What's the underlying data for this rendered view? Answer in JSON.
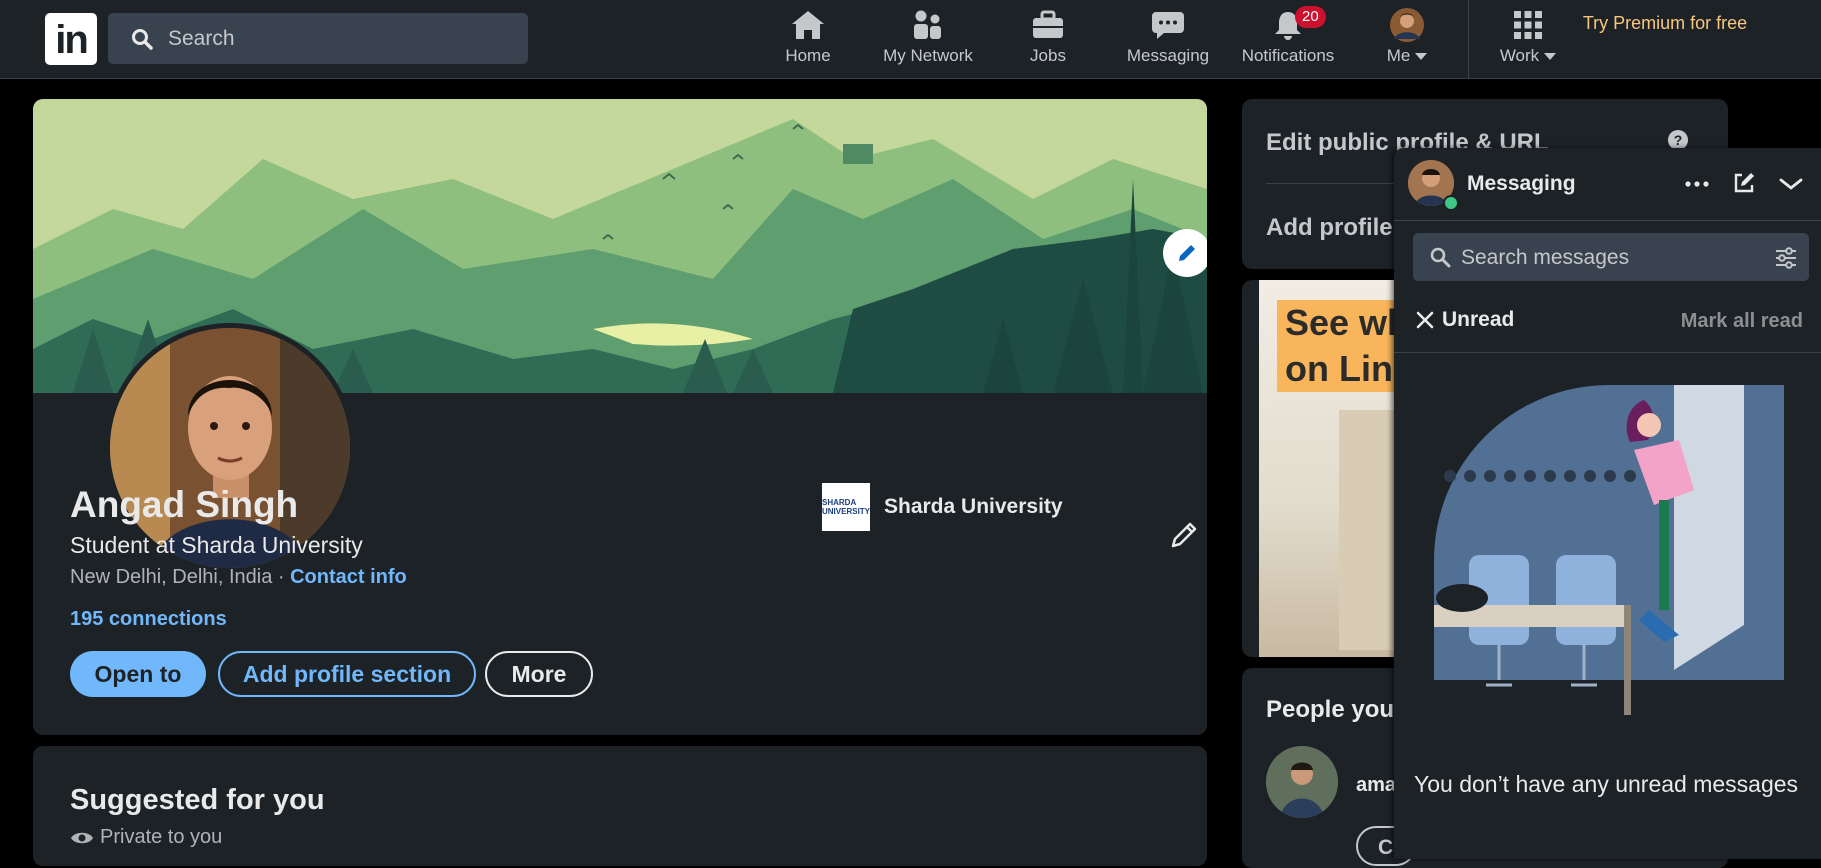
{
  "nav": {
    "search_placeholder": "Search",
    "items": [
      {
        "label": "Home",
        "icon": "home-icon"
      },
      {
        "label": "My Network",
        "icon": "network-icon"
      },
      {
        "label": "Jobs",
        "icon": "briefcase-icon"
      },
      {
        "label": "Messaging",
        "icon": "chat-icon"
      },
      {
        "label": "Notifications",
        "icon": "bell-icon",
        "badge": "20"
      },
      {
        "label": "Me",
        "icon": "avatar"
      },
      {
        "label": "Work",
        "icon": "grid-icon"
      }
    ],
    "premium": "Try Premium for free"
  },
  "profile": {
    "name": "Angad Singh",
    "headline": "Student at Sharda University",
    "location": "New Delhi, Delhi, India ·",
    "contact_info": "Contact info",
    "connections": "195 connections",
    "school": "Sharda University",
    "school_logo_text": "SHARDA UNIVERSITY",
    "buttons": {
      "open_to": "Open to",
      "add_section": "Add profile section",
      "more": "More"
    }
  },
  "suggested": {
    "title": "Suggested for you",
    "subtitle": "Private to you"
  },
  "right": {
    "edit_public": "Edit public profile & URL",
    "add_profile": "Add profile",
    "ad_line1": "See wh",
    "ad_line2": "on Link",
    "people_title": "People you",
    "person_name": "ama",
    "follow_btn": "C"
  },
  "messaging": {
    "title": "Messaging",
    "search_placeholder": "Search messages",
    "filter": "Unread",
    "mark_all": "Mark all read",
    "empty": "You don’t have any unread messages"
  },
  "colors": {
    "accent": "#71b7fb",
    "card": "#1d2226",
    "badge": "#cb112d",
    "premium": "#f8c77e"
  }
}
